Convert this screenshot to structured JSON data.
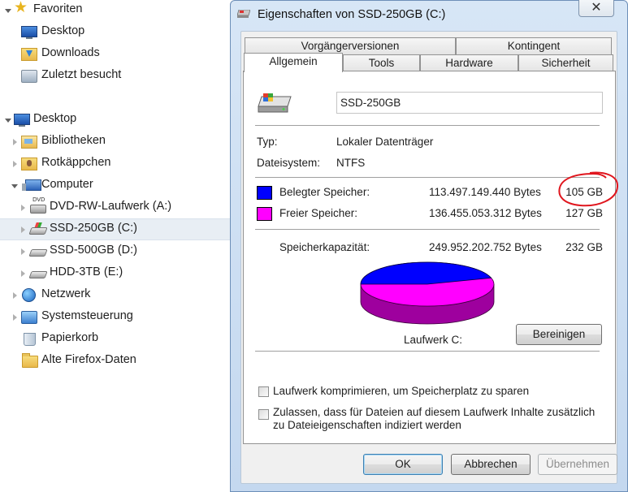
{
  "nav": {
    "items": [
      {
        "label": "Favoriten",
        "icon": "star-icon"
      },
      {
        "label": "Desktop",
        "icon": "desktop-icon"
      },
      {
        "label": "Downloads",
        "icon": "downloads-folder-icon"
      },
      {
        "label": "Zuletzt besucht",
        "icon": "recent-places-icon"
      },
      {
        "label": "Desktop",
        "icon": "desktop-icon"
      },
      {
        "label": "Bibliotheken",
        "icon": "libraries-icon"
      },
      {
        "label": "Rotkäppchen",
        "icon": "user-folder-icon"
      },
      {
        "label": "Computer",
        "icon": "computer-icon"
      },
      {
        "label": "DVD-RW-Laufwerk (A:)",
        "icon": "dvd-drive-icon"
      },
      {
        "label": "SSD-250GB (C:)",
        "icon": "system-drive-icon"
      },
      {
        "label": "SSD-500GB (D:)",
        "icon": "hard-drive-icon"
      },
      {
        "label": "HDD-3TB (E:)",
        "icon": "hard-drive-icon"
      },
      {
        "label": "Netzwerk",
        "icon": "network-icon"
      },
      {
        "label": "Systemsteuerung",
        "icon": "control-panel-icon"
      },
      {
        "label": "Papierkorb",
        "icon": "recycle-bin-icon"
      },
      {
        "label": "Alte Firefox-Daten",
        "icon": "folder-icon"
      }
    ]
  },
  "dialog": {
    "title": "Eigenschaften von SSD-250GB (C:)",
    "close_label": "✕",
    "tabs_top": [
      "Vorgängerversionen",
      "Kontingent"
    ],
    "tabs_bottom": [
      "Allgemein",
      "Tools",
      "Hardware",
      "Sicherheit"
    ],
    "active_tab": "Allgemein",
    "drive_name": "SSD-250GB",
    "type_label": "Typ:",
    "type_value": "Lokaler Datenträger",
    "fs_label": "Dateisystem:",
    "fs_value": "NTFS",
    "used": {
      "label": "Belegter Speicher:",
      "bytes": "113.497.149.440 Bytes",
      "size": "105 GB",
      "color": "#0000ff"
    },
    "free": {
      "label": "Freier Speicher:",
      "bytes": "136.455.053.312 Bytes",
      "size": "127 GB",
      "color": "#ff00ff"
    },
    "capacity": {
      "label": "Speicherkapazität:",
      "bytes": "249.952.202.752 Bytes",
      "size": "232 GB"
    },
    "used_fraction": 0.454,
    "drive_caption": "Laufwerk C:",
    "cleanup_button": "Bereinigen",
    "compress_label": "Laufwerk komprimieren, um Speicherplatz zu sparen",
    "compress_checked": false,
    "index_label_1": "Zulassen, dass für Dateien auf diesem Laufwerk Inhalte zusätzlich",
    "index_label_2": "zu Dateieigenschaften indiziert werden",
    "index_checked": false,
    "ok_button": "OK",
    "cancel_button": "Abbrechen",
    "apply_button": "Übernehmen",
    "annotation_color": "#e0161e"
  }
}
